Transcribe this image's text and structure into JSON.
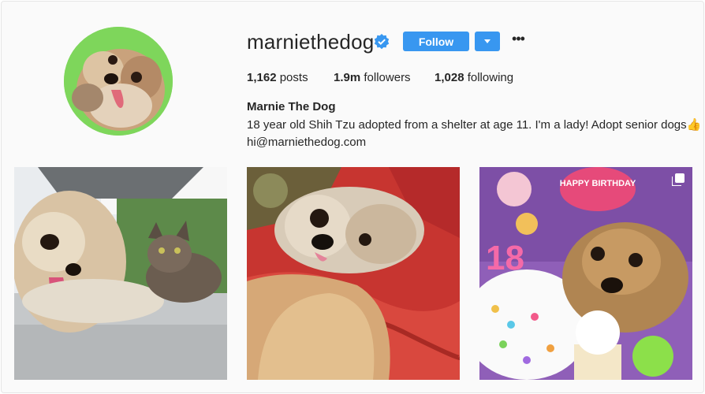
{
  "profile": {
    "username": "marniethedog",
    "verified": true,
    "follow_label": "Follow",
    "more_label": "•••",
    "stats": {
      "posts_count": "1,162",
      "posts_label": "posts",
      "followers_count": "1.9m",
      "followers_label": "followers",
      "following_count": "1,028",
      "following_label": "following"
    },
    "bio": {
      "name": "Marnie The Dog",
      "text": "18 year old Shih Tzu adopted from a shelter at age 11. I'm a lady! Adopt senior dogs👍",
      "link": "hi@marniethedog.com"
    }
  },
  "posts": [
    {
      "subject": "dog-and-cat-photo"
    },
    {
      "subject": "dog-on-red-blanket-photo"
    },
    {
      "subject": "dog-birthday-cake-photo",
      "badge": "multiple-photos-icon"
    }
  ],
  "post_3_text": {
    "banner": "HAPPY BIRTHDAY",
    "number": "18"
  },
  "colors": {
    "accent": "#3897f0",
    "verified": "#3897f0",
    "avatar_bg": "#7ed65b"
  }
}
